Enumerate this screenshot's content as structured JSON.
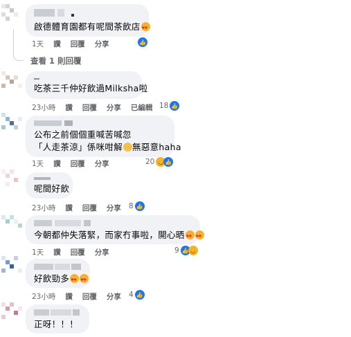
{
  "comments": [
    {
      "text": "啟德體育園都有呢間茶飲店",
      "time": "1天",
      "like": "讚",
      "reply": "回覆",
      "share": "分享",
      "edited": "",
      "count": ""
    },
    {
      "text": "吃茶三千仲好飲過Milksha啦",
      "time": "23小時",
      "like": "讚",
      "reply": "回覆",
      "share": "分享",
      "edited": "已編輯",
      "count": "18"
    },
    {
      "text": "公布之前個個重喊苦喊忽",
      "text2": "「人走茶涼」係咪咁解",
      "text2b": "無惡意haha",
      "time": "1天",
      "like": "讚",
      "reply": "回覆",
      "share": "分享",
      "edited": "",
      "count": "20"
    },
    {
      "text": "呢間好飲",
      "time": "23小時",
      "like": "讚",
      "reply": "回覆",
      "share": "分享",
      "edited": "",
      "count": "8"
    },
    {
      "text": "今朝都仲失落緊，而家冇事啦，開心晒",
      "time": "1天",
      "like": "讚",
      "reply": "回覆",
      "share": "分享",
      "edited": "",
      "count": "9"
    },
    {
      "text": "好飲勁多",
      "time": "23小時",
      "like": "讚",
      "reply": "回覆",
      "share": "分享",
      "edited": "",
      "count": "4"
    },
    {
      "text": "正呀！！！"
    }
  ],
  "thread": {
    "view_replies": "查看 1 則回覆"
  },
  "icons": {
    "like": "like-icon",
    "haha": "haha-icon",
    "love_eyes": "heart-eyes-emoji",
    "rofl": "rofl-emoji",
    "smiling_hearts": "smiling-hearts-emoji"
  },
  "colors": {
    "bubble": "#f0f2f5",
    "like_blue": "#1877f2",
    "meta_gray": "#65676b"
  }
}
